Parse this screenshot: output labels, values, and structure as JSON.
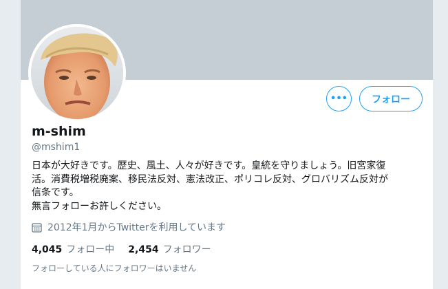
{
  "profile": {
    "display_name": "m-shim",
    "handle": "@mshim1",
    "bio_lines": [
      "日本が大好きです。歴史、風土、人々が好きです。皇統を守りましょう。旧宮家復",
      "活。消費税増税廃案、移民法反対、憲法改正、ポリコレ反対、グロバリズム反対が",
      "信条です。",
      "無言フォローお許しください。"
    ],
    "joined": "2012年1月からTwitterを利用しています"
  },
  "actions": {
    "more_label": "•••",
    "follow_label": "フォロー"
  },
  "stats": {
    "following_count": "4,045",
    "following_label": "フォロー中",
    "followers_count": "2,454",
    "followers_label": "フォロワー"
  },
  "no_mutual_text": "フォローしている人にフォロワーはいません",
  "icons": {
    "calendar": "calendar-icon",
    "more": "more-horizontal-icon"
  },
  "colors": {
    "accent": "#1da1f2",
    "banner": "#c5ced5",
    "muted": "#657786",
    "text": "#14171a"
  }
}
